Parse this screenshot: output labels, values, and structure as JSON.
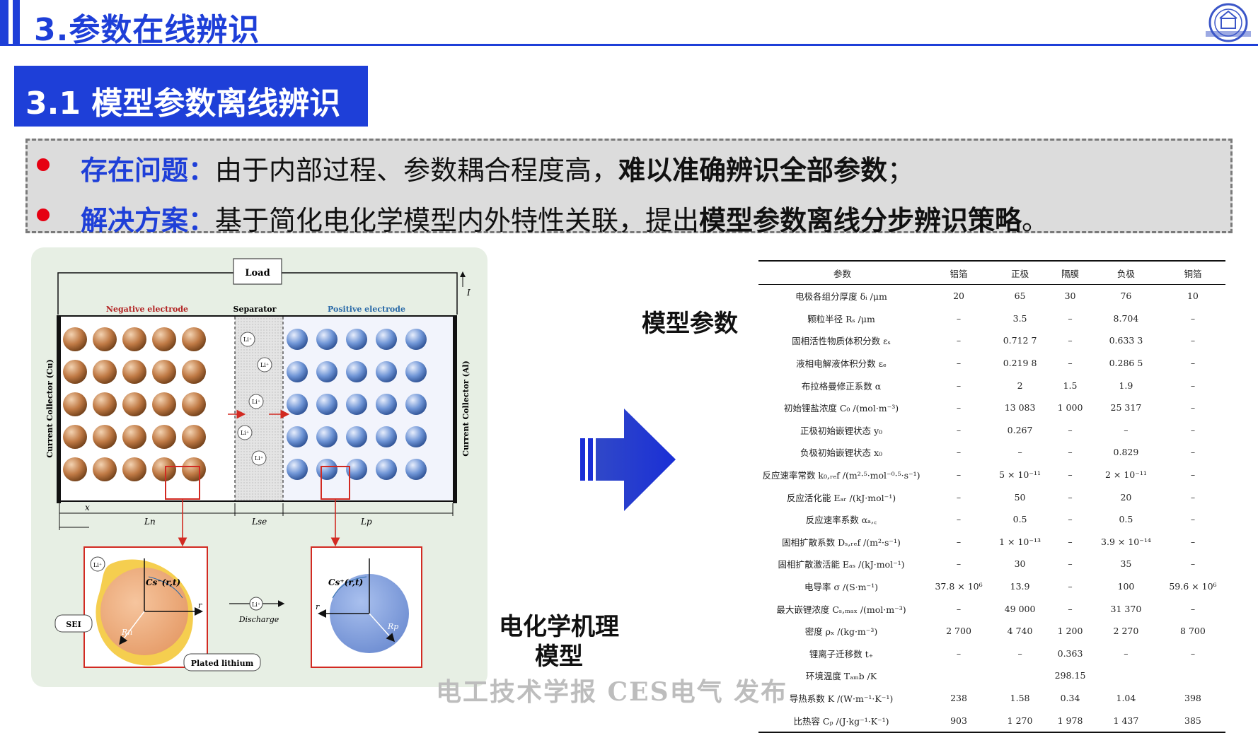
{
  "header": {
    "title": "3.参数在线辨识",
    "accent_color": "#1e3fd8"
  },
  "subsection": {
    "title": "3.1 模型参数离线辨识"
  },
  "problems": [
    {
      "key": "存在问题：",
      "text": "由于内部过程、参数耦合程度高，",
      "bold": "难以准确辨识全部参数",
      "tail": "；"
    },
    {
      "key": "解决方案：",
      "text": "基于简化电化学模型内外特性关联，提出",
      "bold": "模型参数离线分步辨识策略",
      "tail": "。"
    }
  ],
  "diagram": {
    "load": "Load",
    "current": "I",
    "negative_electrode": "Negative electrode",
    "separator": "Separator",
    "positive_electrode": "Positive electrode",
    "collector_left": "Current Collector (Cu)",
    "collector_right": "Current Collector (Al)",
    "ion": "Li⁺",
    "dim_x": "x",
    "dim_ln": "Ln",
    "dim_lse": "Lse",
    "dim_lp": "Lp",
    "neg_conc": "Cs⁻(r,t)",
    "pos_conc": "Cs⁺(r,t)",
    "axis_r": "r",
    "radius_n": "Rn",
    "radius_p": "Rp",
    "discharge": "Discharge",
    "sei": "SEI",
    "plated": "Plated lithium",
    "neg_color": "#c07a45",
    "pos_color": "#6f95d6",
    "highlight_color": "#d22a22"
  },
  "labels": {
    "model_params": "模型参数",
    "mechanism_line1": "电化学机理",
    "mechanism_line2": "模型"
  },
  "table": {
    "headers": [
      "参数",
      "铝箔",
      "正极",
      "隔膜",
      "负极",
      "铜箔"
    ],
    "rows": [
      [
        "电极各组分厚度 δᵢ /μm",
        "20",
        "65",
        "30",
        "76",
        "10"
      ],
      [
        "颗粒半径 Rₛ /μm",
        "–",
        "3.5",
        "–",
        "8.704",
        "–"
      ],
      [
        "固相活性物质体积分数 εₛ",
        "–",
        "0.712 7",
        "–",
        "0.633 3",
        "–"
      ],
      [
        "液相电解液体积分数 εₑ",
        "–",
        "0.219 8",
        "–",
        "0.286 5",
        "–"
      ],
      [
        "布拉格曼修正系数 α",
        "–",
        "2",
        "1.5",
        "1.9",
        "–"
      ],
      [
        "初始锂盐浓度 C₀ /(mol·m⁻³)",
        "–",
        "13 083",
        "1 000",
        "25 317",
        "–"
      ],
      [
        "正极初始嵌锂状态 y₀",
        "–",
        "0.267",
        "–",
        "–",
        "–"
      ],
      [
        "负极初始嵌锂状态 x₀",
        "–",
        "–",
        "–",
        "0.829",
        "–"
      ],
      [
        "反应速率常数 k₀,ᵣₑf /(m²·⁵·mol⁻⁰·⁵·s⁻¹)",
        "–",
        "5 × 10⁻¹¹",
        "–",
        "2 × 10⁻¹¹",
        "–"
      ],
      [
        "反应活化能 Eₐᵣ /(kJ·mol⁻¹)",
        "–",
        "50",
        "–",
        "20",
        "–"
      ],
      [
        "反应速率系数 αₐ,꜀",
        "–",
        "0.5",
        "–",
        "0.5",
        "–"
      ],
      [
        "固相扩散系数 Dₛ,ᵣₑf /(m²·s⁻¹)",
        "–",
        "1 × 10⁻¹³",
        "–",
        "3.9 × 10⁻¹⁴",
        "–"
      ],
      [
        "固相扩散激活能 Eₐₛ /(kJ·mol⁻¹)",
        "–",
        "30",
        "–",
        "35",
        "–"
      ],
      [
        "电导率 σ /(S·m⁻¹)",
        "37.8 × 10⁶",
        "13.9",
        "–",
        "100",
        "59.6 × 10⁶"
      ],
      [
        "最大嵌锂浓度 Cₛ,ₘₐₓ /(mol·m⁻³)",
        "–",
        "49 000",
        "–",
        "31 370",
        "–"
      ],
      [
        "密度 ρₓ /(kg·m⁻³)",
        "2 700",
        "4 740",
        "1 200",
        "2 270",
        "8 700"
      ],
      [
        "锂离子迁移数 t₊",
        "–",
        "–",
        "0.363",
        "–",
        "–"
      ],
      [
        "环境温度 Tₐₘb /K",
        "",
        "",
        "298.15",
        "",
        ""
      ],
      [
        "导热系数 K /(W·m⁻¹·K⁻¹)",
        "238",
        "1.58",
        "0.34",
        "1.04",
        "398"
      ],
      [
        "比热容 Cₚ /(J·kg⁻¹·K⁻¹)",
        "903",
        "1 270",
        "1 978",
        "1 437",
        "385"
      ]
    ]
  },
  "watermark": "电工技术学报 CES电气 发布"
}
